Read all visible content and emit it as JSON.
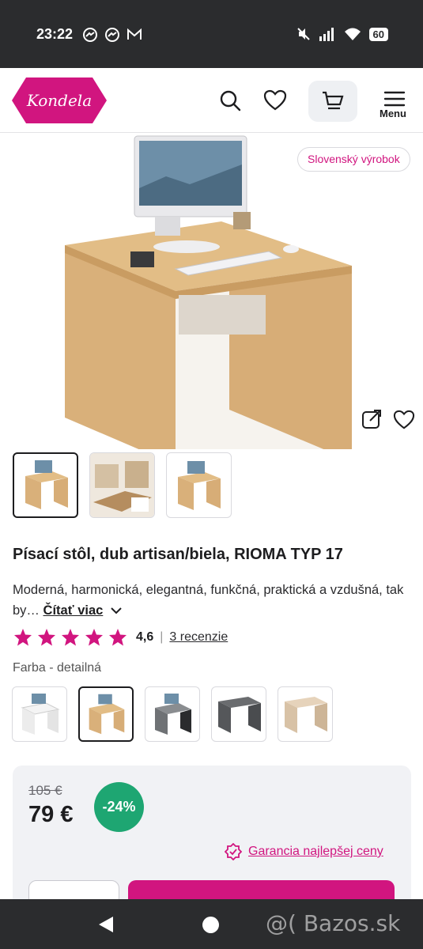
{
  "status_bar": {
    "time": "23:22",
    "battery": "60"
  },
  "header": {
    "logo_text": "Kondela",
    "menu_label": "Menu"
  },
  "badge": "Slovenský výrobok",
  "product": {
    "title": "Písací stôl, dub artisan/biela, RIOMA TYP 17",
    "description": "Moderná, harmonická, elegantná, funkčná, praktická a vzdušná, tak by…",
    "read_more": "Čítať viac",
    "rating": "4,6",
    "rating_stars": 5,
    "reviews": "3 recenzie"
  },
  "color": {
    "label": "Farba - detailná",
    "swatches": [
      "white",
      "oak-white",
      "grey-black",
      "graphite",
      "sonoma"
    ]
  },
  "pricing": {
    "old_price": "105 €",
    "new_price": "79 €",
    "discount": "-24%",
    "guarantee": "Garancia najlepšej ceny"
  },
  "watermark": "@( Bazos.sk",
  "colors": {
    "brand": "#d1157f",
    "discount": "#1ea672",
    "bar": "#2b2c2e"
  }
}
